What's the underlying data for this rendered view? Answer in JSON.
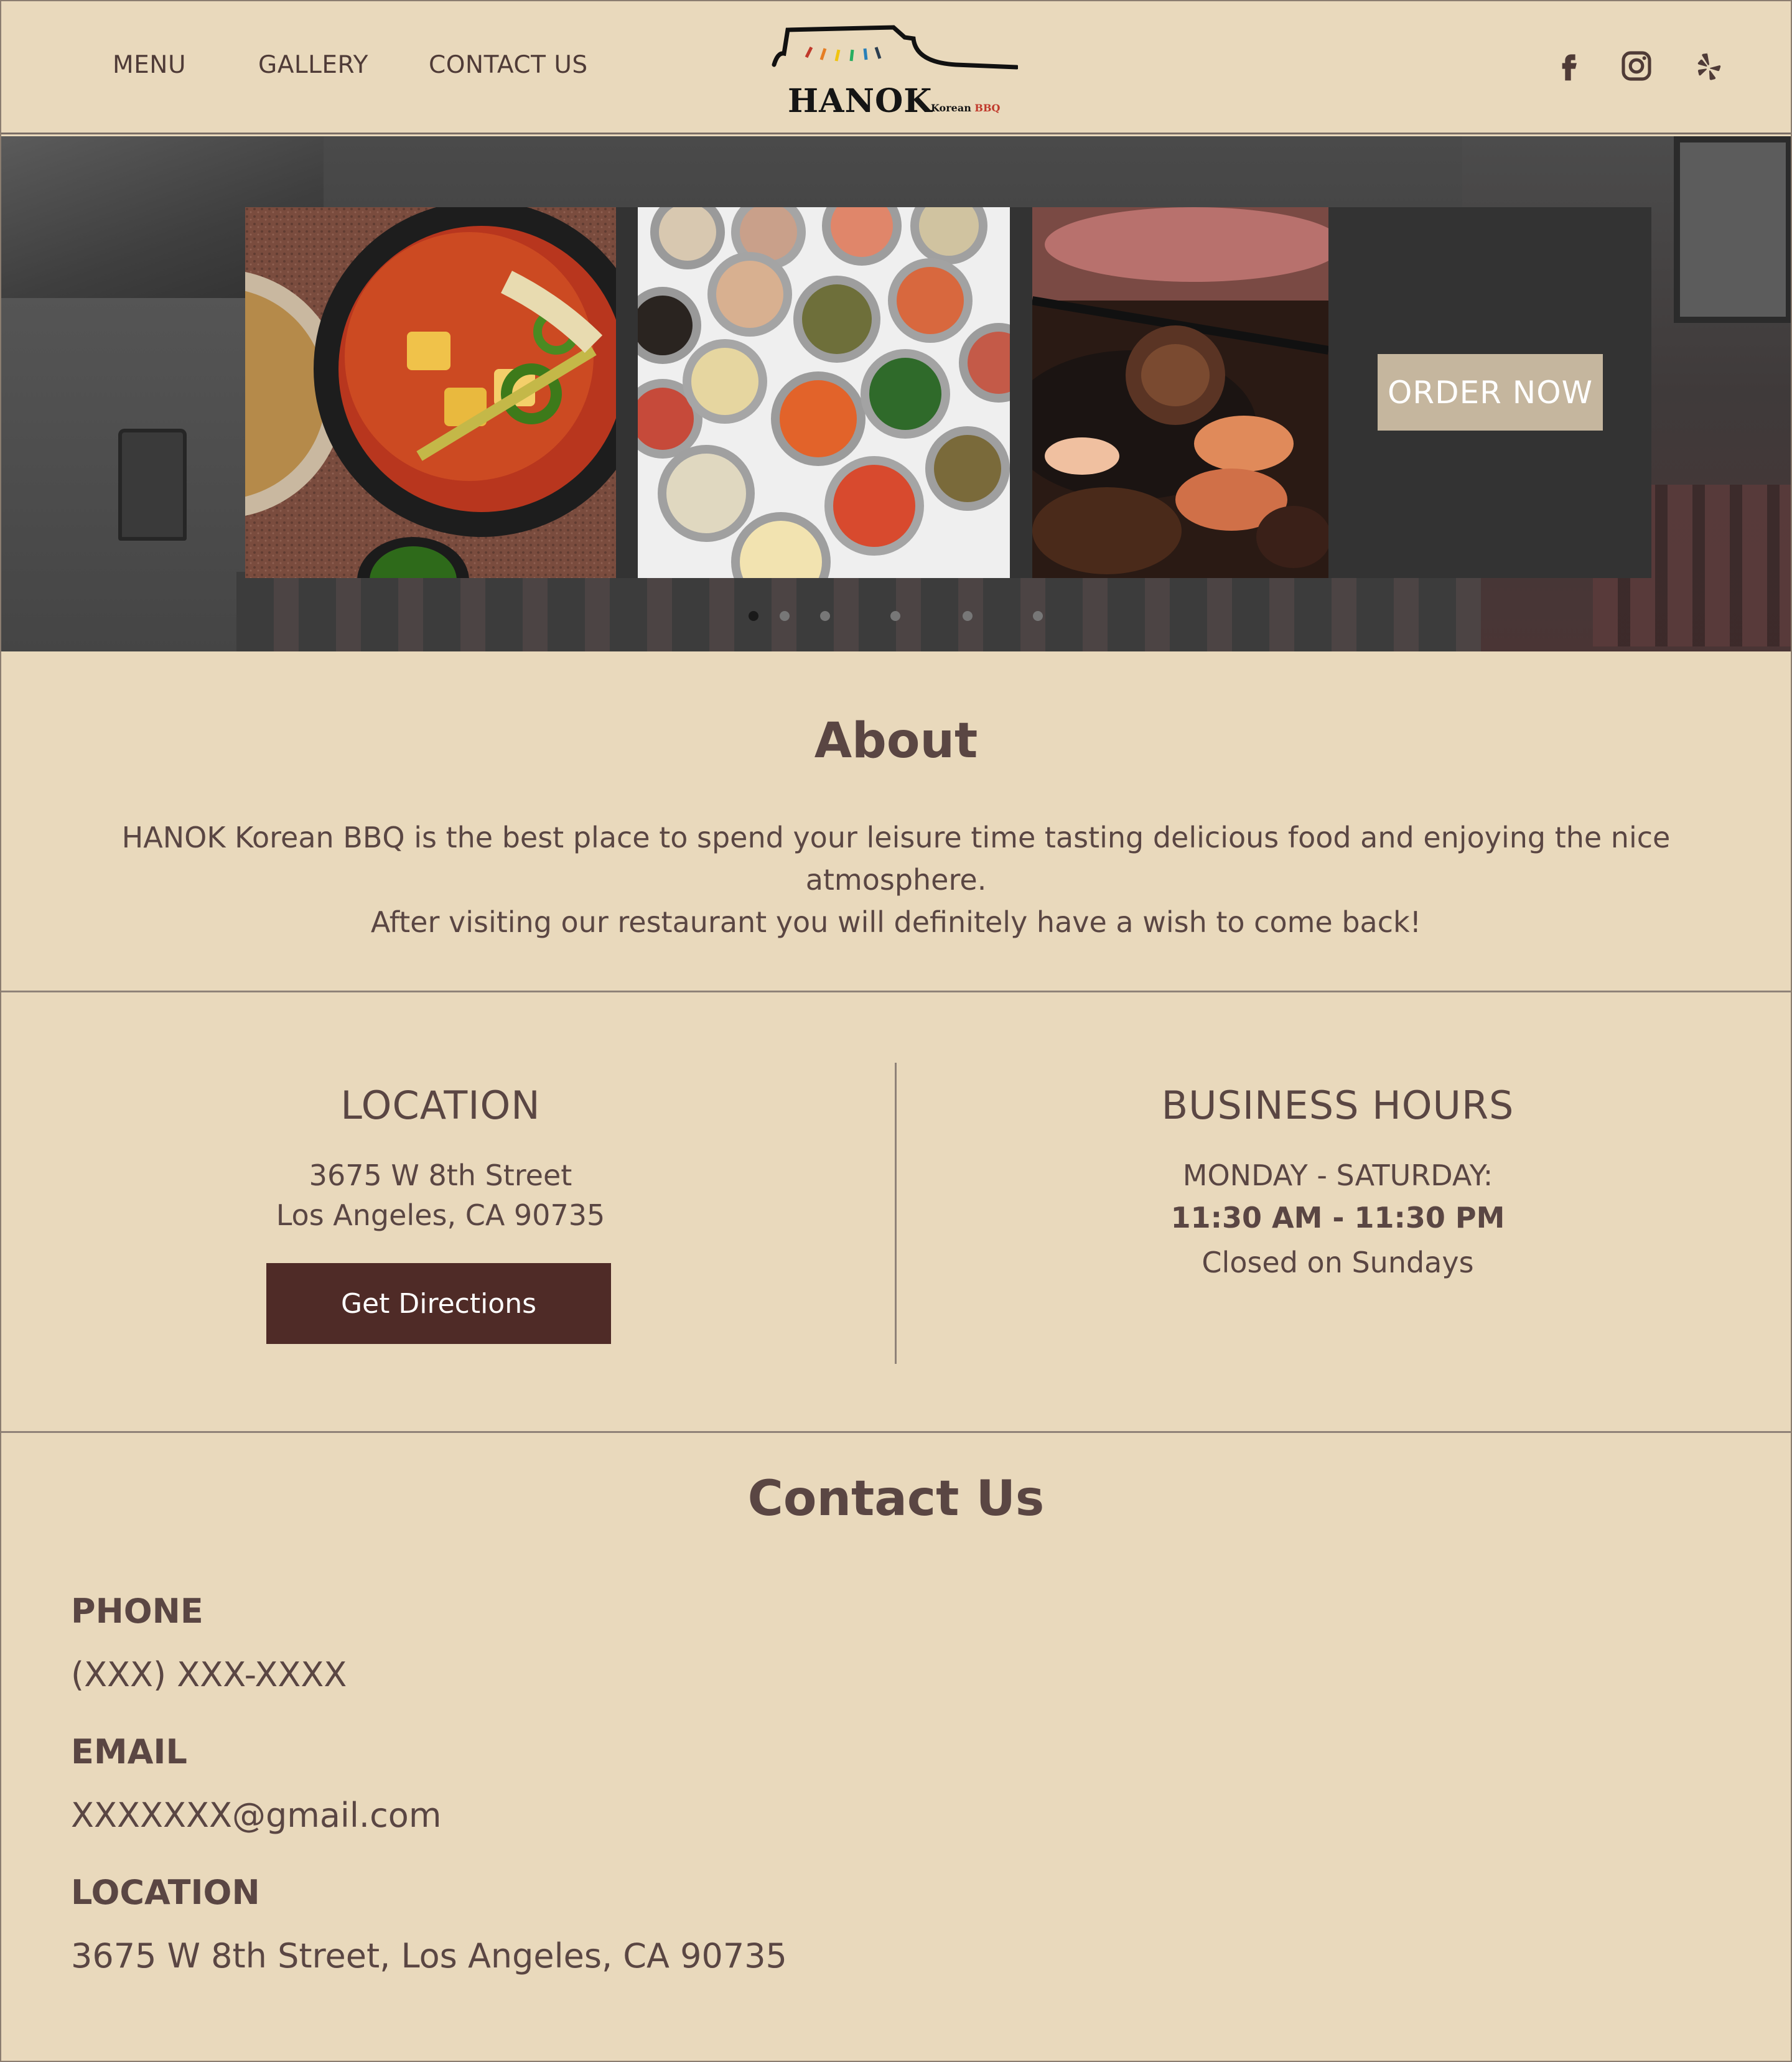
{
  "nav": {
    "menu": "MENU",
    "gallery": "GALLERY",
    "contact": "CONTACT US"
  },
  "logo": {
    "name": "HANOK",
    "sub_korean": "Korean",
    "sub_bbq": "BBQ"
  },
  "social": [
    "facebook-icon",
    "instagram-icon",
    "yelp-icon"
  ],
  "hero": {
    "slides": [
      "kimchi-stew-photo",
      "banchan-side-dishes-photo",
      "grilled-bbq-meat-photo"
    ],
    "order_label": "ORDER NOW",
    "dots_count": 6,
    "active_dot": 1
  },
  "about": {
    "title": "About",
    "line1": "HANOK Korean BBQ is the best place to spend your leisure time tasting delicious food and enjoying the nice atmosphere.",
    "line2": "After visiting our restaurant you will definitely have a wish to come back!"
  },
  "location": {
    "title": "LOCATION",
    "street": "3675 W 8th Street",
    "city": "Los Angeles, CA 90735",
    "button": "Get Directions"
  },
  "hours": {
    "title": "BUSINESS HOURS",
    "days": "MONDAY - SATURDAY:",
    "time": "11:30 AM - 11:30 PM",
    "closed": "Closed on Sundays"
  },
  "contact": {
    "title": "Contact Us",
    "phone_label": "PHONE",
    "phone": "(XXX) XXX-XXXX",
    "email_label": "EMAIL",
    "email": "XXXXXXX@gmail.com",
    "location_label": "LOCATION",
    "location": "3675 W 8th Street, Los Angeles, CA 90735"
  },
  "colors": {
    "background": "#e9d9bc",
    "text": "#5a4643",
    "button_dark": "#4f2b27",
    "button_light": "#c5b69e"
  }
}
